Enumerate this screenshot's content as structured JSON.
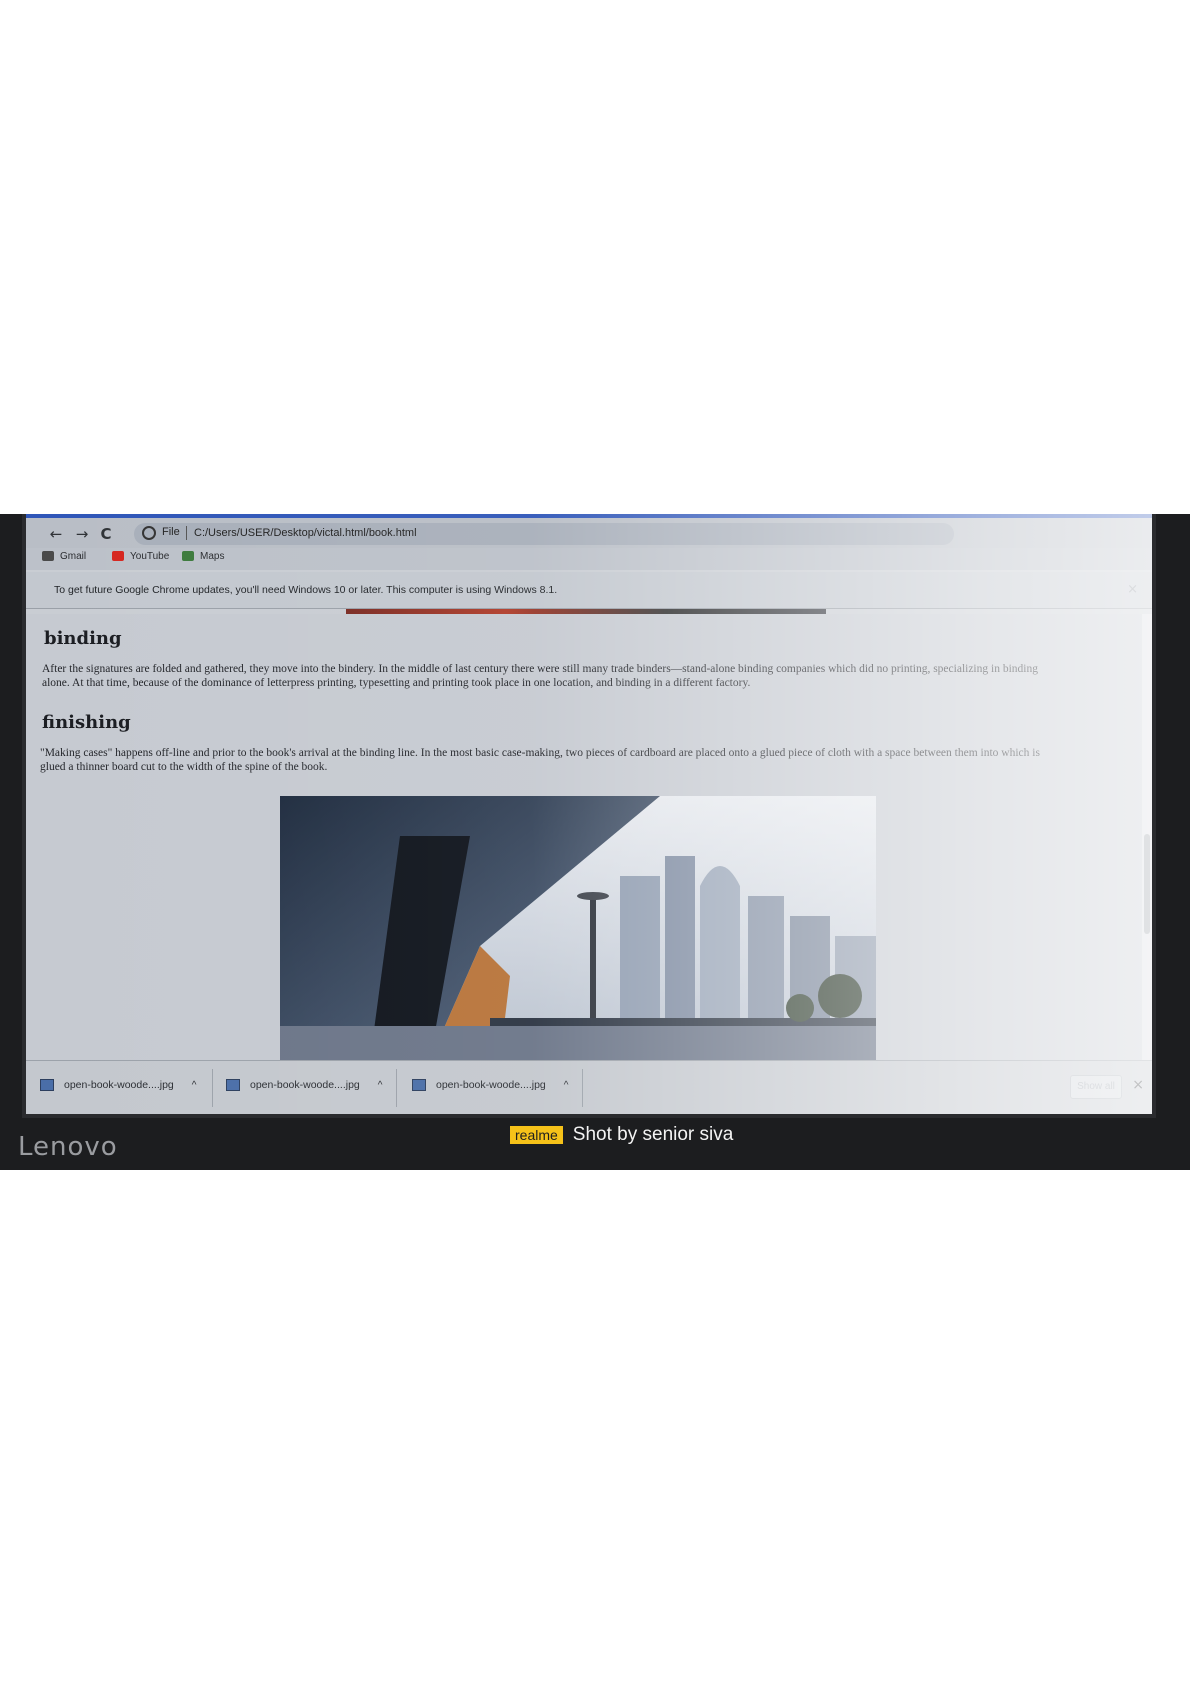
{
  "browser": {
    "url_scheme_label": "File",
    "url": "C:/Users/USER/Desktop/victal.html/book.html",
    "back_icon": "←",
    "forward_icon": "→",
    "reload_icon": "C",
    "bookmarks": [
      {
        "label": "Gmail",
        "icon": "gmail-icon",
        "color": "#4a4a4a"
      },
      {
        "label": "YouTube",
        "icon": "youtube-icon",
        "color": "#d6261f"
      },
      {
        "label": "Maps",
        "icon": "maps-icon",
        "color": "#3c7a3c"
      }
    ],
    "infobar": {
      "text": "To get future Google Chrome updates, you'll need Windows 10 or later. This computer is using Windows 8.1.",
      "close_icon": "×"
    }
  },
  "page": {
    "sections": [
      {
        "heading": "binding",
        "text": "After the signatures are folded and gathered, they move into the bindery. In the middle of last century there were still many trade binders—stand-alone binding companies which did no printing, specializing in binding alone. At that time, because of the dominance of letterpress printing, typesetting and printing took place in one location, and binding in a different factory."
      },
      {
        "heading": "finishing",
        "text": "\"Making cases\" happens off-line and prior to the book's arrival at the binding line. In the most basic case-making, two pieces of cardboard are placed onto a glued piece of cloth with a space between them into which is glued a thinner board cut to the width of the spine of the book."
      }
    ],
    "hero_image": "city-skyline-image"
  },
  "downloads": {
    "items": [
      {
        "filename": "open-book-woode....jpg",
        "chevron": "^"
      },
      {
        "filename": "open-book-woode....jpg",
        "chevron": "^"
      },
      {
        "filename": "open-book-woode....jpg",
        "chevron": "^"
      }
    ],
    "show_all_label": "Show all",
    "close_icon": "×"
  },
  "device": {
    "brand": "Lenovo"
  },
  "watermark": {
    "brand": "realme",
    "text": "Shot by senior siva"
  }
}
